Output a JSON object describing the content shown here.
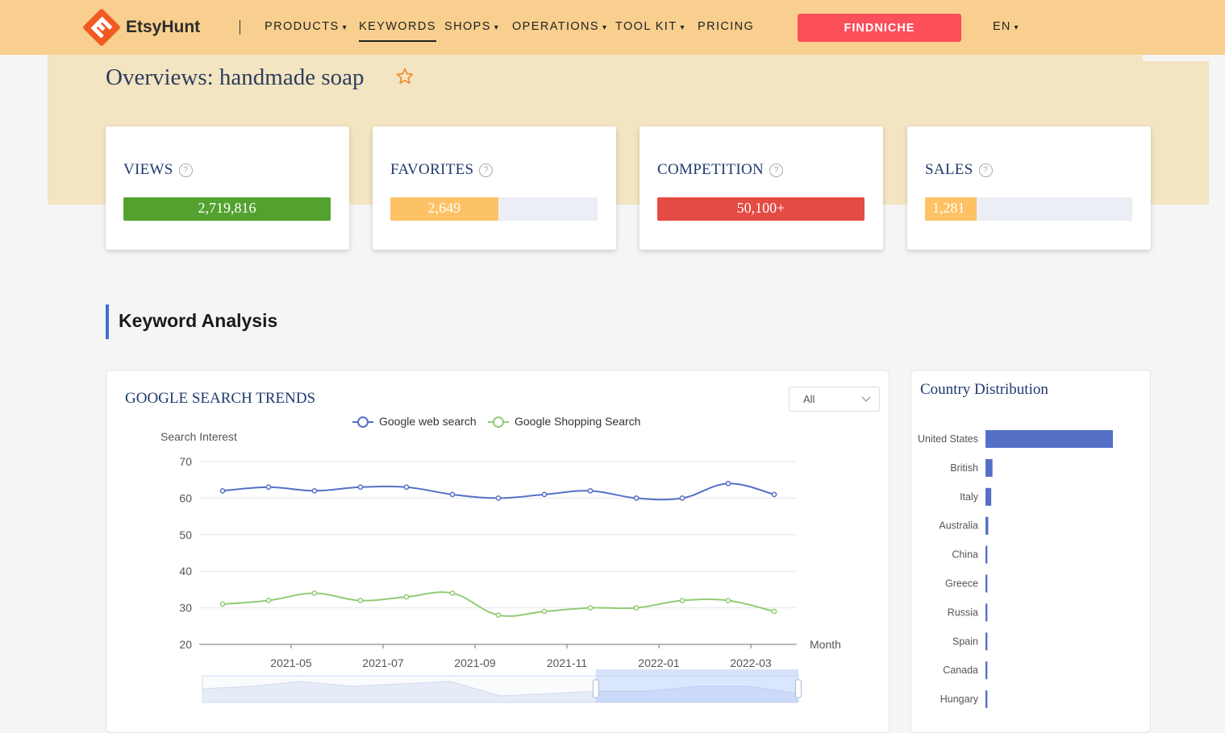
{
  "nav": {
    "logo_text": "EtsyHunt",
    "items": [
      {
        "label": "PRODUCTS",
        "caret": "▾"
      },
      {
        "label": "KEYWORDS",
        "caret": ""
      },
      {
        "label": "SHOPS",
        "caret": "▾"
      },
      {
        "label": "OPERATIONS",
        "caret": "▾"
      },
      {
        "label": "TOOL KIT",
        "caret": "▾"
      },
      {
        "label": "PRICING",
        "caret": ""
      }
    ],
    "active_item": "KEYWORDS",
    "cta_label": "FINDNICHE",
    "lang_label": "EN",
    "lang_caret": "▾",
    "colors": {
      "bar": "#f8cf8e",
      "cta": "#fb4f5a",
      "logo": "#f15a22"
    }
  },
  "overview": {
    "title": "Overviews: handmade soap",
    "favorite_icon": "star-outline-icon",
    "help_icon_glyph": "?",
    "cards": [
      {
        "label": "VIEWS",
        "value": "2,719,816",
        "fill_fraction": 1.0,
        "color": "#53a22f"
      },
      {
        "label": "FAVORITES",
        "value": "2,649",
        "fill_fraction": 0.52,
        "color": "#fdc265"
      },
      {
        "label": "COMPETITION",
        "value": "50,100+",
        "fill_fraction": 1.0,
        "color": "#e44b42"
      },
      {
        "label": "SALES",
        "value": "1,281",
        "fill_fraction": 0.25,
        "color": "#fdc265"
      }
    ]
  },
  "section": {
    "title": "Keyword Analysis",
    "accent": "#3d6fd0"
  },
  "trends": {
    "title": "GOOGLE SEARCH TRENDS",
    "filter_value": "All"
  },
  "country": {
    "title": "Country Distribution"
  },
  "chart_data": [
    {
      "type": "line",
      "title": "GOOGLE SEARCH TRENDS",
      "ylabel": "Search Interest",
      "xlabel": "Month",
      "ylim": [
        20,
        70
      ],
      "yticks": [
        20,
        30,
        40,
        50,
        60,
        70
      ],
      "x": [
        "2021-04",
        "2021-05",
        "2021-06",
        "2021-07",
        "2021-08",
        "2021-09",
        "2021-10",
        "2021-11",
        "2021-12",
        "2022-01",
        "2022-02",
        "2022-03",
        "2022-04"
      ],
      "xtick_labels": [
        "2021-05",
        "2021-07",
        "2021-09",
        "2021-11",
        "2022-01",
        "2022-03"
      ],
      "series": [
        {
          "name": "Google web search",
          "color": "#5470c6",
          "values": [
            62,
            63,
            62,
            63,
            63,
            61,
            60,
            61,
            62,
            60,
            60,
            64,
            61
          ]
        },
        {
          "name": "Google Shopping Search",
          "color": "#91cc75",
          "values": [
            31,
            32,
            34,
            32,
            33,
            34,
            28,
            29,
            30,
            30,
            32,
            32,
            29
          ]
        }
      ],
      "legend": "top-center",
      "grid": true,
      "zoom_window": [
        0.66,
        1.0
      ]
    },
    {
      "type": "bar",
      "orientation": "horizontal",
      "title": "Country Distribution",
      "categories": [
        "United States",
        "British",
        "Italy",
        "Australia",
        "China",
        "Greece",
        "Russia",
        "Spain",
        "Canada",
        "Hungary"
      ],
      "values": [
        100,
        5.5,
        4.5,
        2.2,
        1.5,
        1.5,
        1.5,
        1.5,
        1.5,
        1.5
      ],
      "color": "#5470c6"
    }
  ]
}
